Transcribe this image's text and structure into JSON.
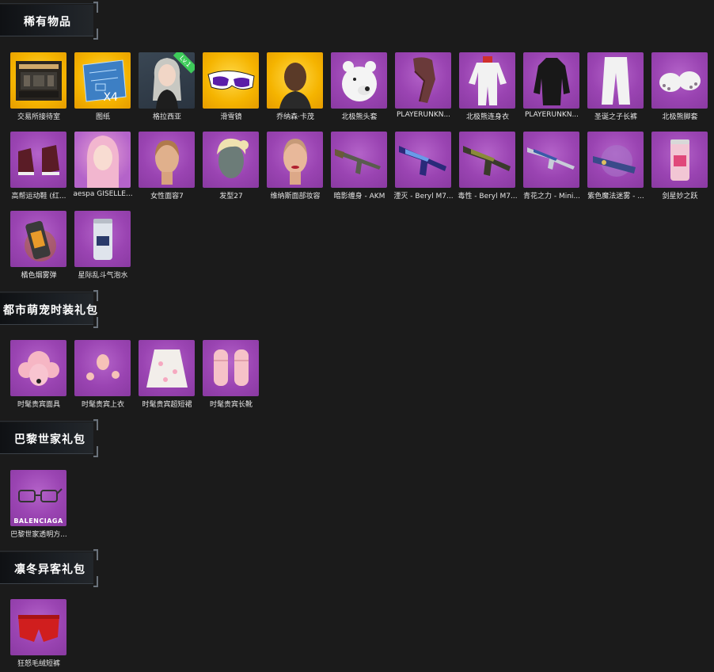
{
  "sections": [
    {
      "title": "稀有物品",
      "items": [
        {
          "label": "交易所接待室",
          "icon": "room-icon"
        },
        {
          "label": "图纸",
          "icon": "blueprint-icon",
          "badge": "X4"
        },
        {
          "label": "格拉西亚",
          "icon": "character-female-icon",
          "badge": "Lv.1"
        },
        {
          "label": "滑雪镜",
          "icon": "ski-goggles-icon"
        },
        {
          "label": "乔纳森·卡茂",
          "icon": "character-male-icon"
        },
        {
          "label": "北极熊头套",
          "icon": "polar-bear-mask-icon"
        },
        {
          "label": "PLAYERUNKN...",
          "icon": "scarf-icon"
        },
        {
          "label": "北极熊连身衣",
          "icon": "bear-suit-icon"
        },
        {
          "label": "PLAYERUNKN...",
          "icon": "black-coat-icon"
        },
        {
          "label": "圣诞之子长裤",
          "icon": "white-pants-icon"
        },
        {
          "label": "北极熊脚套",
          "icon": "bear-feet-icon"
        },
        {
          "label": "高帮运动鞋 (红...",
          "icon": "sneakers-icon"
        },
        {
          "label": "aespa GISELLE...",
          "icon": "face-pink-hair-icon"
        },
        {
          "label": "女性面容7",
          "icon": "female-face-icon"
        },
        {
          "label": "发型27",
          "icon": "hairstyle-icon"
        },
        {
          "label": "维纳斯面部妆容",
          "icon": "makeup-face-icon"
        },
        {
          "label": "暗影缠身 - AKM",
          "icon": "rifle-akm-icon"
        },
        {
          "label": "湮灭 - Beryl M7...",
          "icon": "rifle-beryl-blue-icon"
        },
        {
          "label": "毒性 - Beryl M7...",
          "icon": "rifle-beryl-toxic-icon"
        },
        {
          "label": "青花之力 - Mini...",
          "icon": "rifle-mini-icon"
        },
        {
          "label": "紫色魔法迷雾 - ...",
          "icon": "launcher-icon"
        },
        {
          "label": "剑星妙之跃",
          "icon": "drink-can-pink-icon"
        },
        {
          "label": "橘色烟雾弹",
          "icon": "smoke-grenade-icon"
        },
        {
          "label": "星际乱斗气泡水",
          "icon": "drink-can-silver-icon"
        }
      ]
    },
    {
      "title": "都市萌宠时装礼包",
      "items": [
        {
          "label": "时髦贵宾面具",
          "icon": "poodle-mask-icon"
        },
        {
          "label": "时髦贵宾上衣",
          "icon": "poodle-top-icon"
        },
        {
          "label": "时髦贵宾超短裙",
          "icon": "poodle-skirt-icon"
        },
        {
          "label": "时髦贵宾长靴",
          "icon": "poodle-boots-icon"
        }
      ]
    },
    {
      "title": "巴黎世家礼包",
      "items": [
        {
          "label": "巴黎世家透明方...",
          "icon": "glasses-icon",
          "badge": "BALENCIAGA"
        }
      ]
    },
    {
      "title": "凛冬异客礼包",
      "items": [
        {
          "label": "狂怒毛绒短裤",
          "icon": "red-shorts-icon"
        }
      ]
    }
  ]
}
